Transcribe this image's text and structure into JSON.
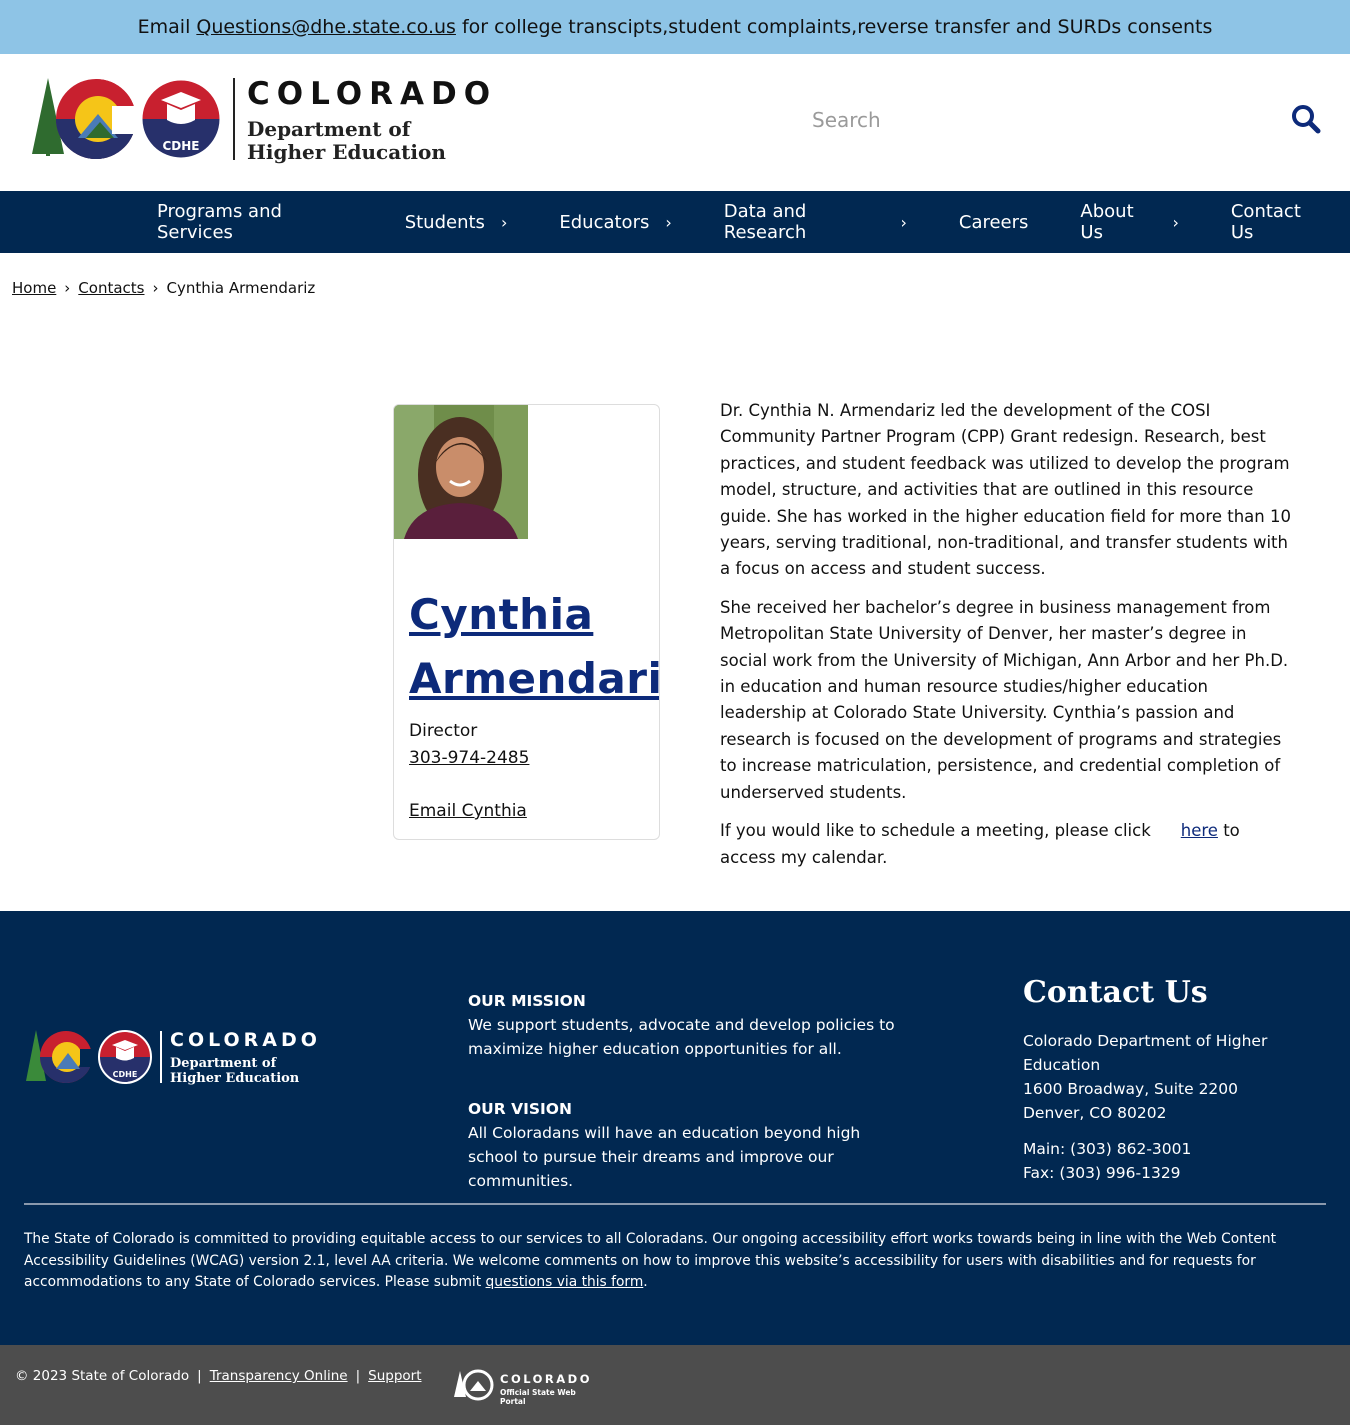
{
  "banner": {
    "prefix": "Email",
    "email": "Questions@dhe.state.co.us",
    "suffix": "for college transcipts,student complaints,reverse transfer and SURDs consents"
  },
  "header": {
    "logo": {
      "title": "COLORADO",
      "line1": "Department of",
      "line2": "Higher Education",
      "badge": "CDHE"
    },
    "search": {
      "placeholder": "Search",
      "icon": "search-icon"
    }
  },
  "nav": {
    "items": [
      {
        "label": "Programs and Services",
        "has_submenu": false
      },
      {
        "label": "Students",
        "has_submenu": true
      },
      {
        "label": "Educators",
        "has_submenu": true
      },
      {
        "label": "Data and Research",
        "has_submenu": true
      },
      {
        "label": "Careers",
        "has_submenu": false
      },
      {
        "label": "About Us",
        "has_submenu": true
      },
      {
        "label": "Contact Us",
        "has_submenu": false
      }
    ],
    "chevron": "›"
  },
  "breadcrumb": {
    "items": [
      "Home",
      "Contacts",
      "Cynthia Armendariz"
    ],
    "separator": "›"
  },
  "profile": {
    "name": "Cynthia Armendariz",
    "title": "Director",
    "phone": "303-974-2485",
    "email_label": "Email Cynthia"
  },
  "bio": {
    "p1": "Dr. Cynthia N. Armendariz led the development of the COSI Community Partner Program (CPP) Grant redesign. Research, best practices, and student feedback was utilized to develop the program model, structure, and activities that are outlined in this resource guide. She has worked in the higher education field for more than 10 years, serving traditional, non-traditional, and transfer students with a focus on access and student success.",
    "p2": "She received her bachelor’s degree in business management from Metropolitan State University of Denver, her master’s degree in social work from the University of Michigan, Ann Arbor and her Ph.D. in education and human resource studies/higher education leadership at Colorado State University. Cynthia’s passion and research is focused on the development of programs and strategies to increase matriculation, persistence, and credential completion of underserved students.",
    "p3_before": "If you would like to schedule a meeting, please click",
    "p3_link": "here",
    "p3_after": "to access my calendar."
  },
  "footer": {
    "logo": {
      "title": "COLORADO",
      "line1": "Department of",
      "line2": "Higher Education",
      "badge": "CDHE"
    },
    "mission": {
      "heading": "OUR MISSION",
      "text": "We support students, advocate and develop policies to maximize higher education opportunities for all."
    },
    "vision": {
      "heading": "OUR VISION",
      "text": "All Coloradans will have an education beyond high school to pursue their dreams and improve our communities."
    },
    "contact": {
      "heading": "Contact Us",
      "org": "Colorado Department of Higher Education",
      "address1": "1600 Broadway, Suite 2200",
      "address2": "Denver, CO 80202",
      "main": "Main: (303) 862-3001",
      "fax": "Fax: (303) 996-1329"
    },
    "accessibility": {
      "text": "The State of Colorado is committed to providing equitable access to our services to all Coloradans. Our ongoing accessibility effort works towards being in line with the Web Content Accessibility Guidelines (WCAG) version 2.1, level AA criteria. We welcome comments on how to improve this website’s accessibility for users with disabilities and for requests for accommodations to any State of Colorado services. Please submit",
      "link": "questions via this form",
      "end": "."
    }
  },
  "subfooter": {
    "copyright": "© 2023 State of Colorado",
    "links": [
      "Transparency Online",
      "Support"
    ],
    "state_logo": {
      "title": "COLORADO",
      "subtitle": "Official State Web Portal"
    }
  },
  "colors": {
    "banner": "#8ec4e6",
    "navy": "#012851",
    "link_blue": "#0d2a7a",
    "subfooter": "#4d4d4d"
  }
}
